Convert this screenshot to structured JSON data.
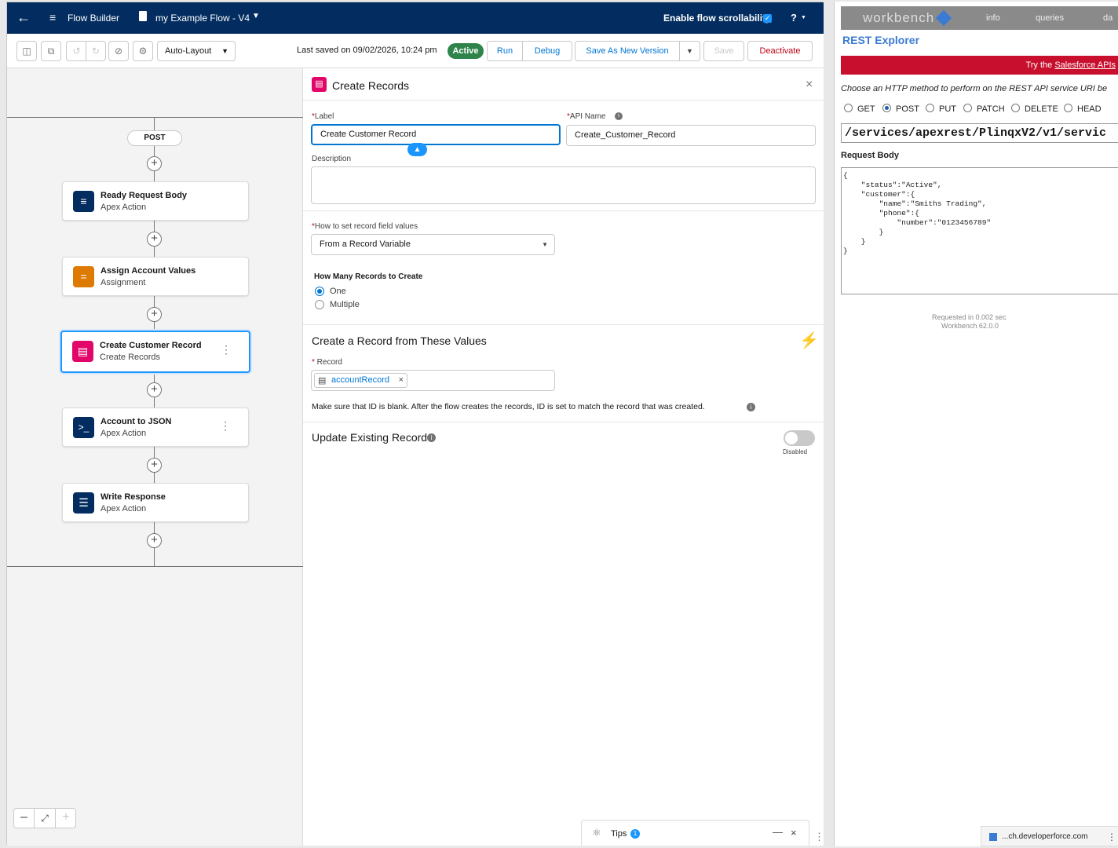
{
  "topbar": {
    "app_name": "Flow Builder",
    "flow_name": "my Example Flow - V4",
    "scroll_label": "Enable flow scrollability",
    "help": "?"
  },
  "toolbar": {
    "layout_select": "Auto-Layout",
    "last_saved": "Last saved on 09/02/2026, 10:24 pm",
    "status_badge": "Active",
    "run": "Run",
    "debug": "Debug",
    "save_as_new": "Save As New Version",
    "save": "Save",
    "deactivate": "Deactivate"
  },
  "canvas": {
    "start_label": "POST",
    "nodes": [
      {
        "title": "Ready Request Body",
        "subtitle": "Apex Action",
        "icon": "apex-action-icon",
        "color": "#032d60"
      },
      {
        "title": "Assign Account Values",
        "subtitle": "Assignment",
        "icon": "assignment-icon",
        "color": "#dd7a01"
      },
      {
        "title": "Create Customer Record",
        "subtitle": "Create Records",
        "icon": "create-records-icon",
        "color": "#e3066a"
      },
      {
        "title": "Account to JSON",
        "subtitle": "Apex Action",
        "icon": "apex-terminal-icon",
        "color": "#032d60"
      },
      {
        "title": "Write Response",
        "subtitle": "Apex Action",
        "icon": "list-icon",
        "color": "#032d60"
      }
    ]
  },
  "panel": {
    "title": "Create Records",
    "label_label": "Label",
    "label_value": "Create Customer Record",
    "api_name_label": "API Name",
    "api_name_value": "Create_Customer_Record",
    "description_label": "Description",
    "how_to_set_label": "How to set record field values",
    "how_to_set_value": "From a Record Variable",
    "how_many_label": "How Many Records to Create",
    "option_one": "One",
    "option_multiple": "Multiple",
    "section_title": "Create a Record from These Values",
    "record_label": "Record",
    "record_pill": "accountRecord",
    "help_text": "Make sure that ID is blank. After the flow creates the records, ID is set to match the record that was created.",
    "update_label": "Update Existing Record",
    "toggle_state": "Disabled"
  },
  "tips": {
    "label": "Tips",
    "count": "1"
  },
  "workbench": {
    "logo": "workbench",
    "menu_info": "info",
    "menu_queries": "queries",
    "menu_cut": "da",
    "title": "REST Explorer",
    "banner_prefix": "Try the ",
    "banner_link": "Salesforce APIs",
    "instruction": "Choose an HTTP method to perform on the REST API service URI be",
    "methods": [
      "GET",
      "POST",
      "PUT",
      "PATCH",
      "DELETE",
      "HEAD"
    ],
    "selected_method": "POST",
    "uri": "/services/apexrest/PlinqxV2/v1/servic",
    "request_body_label": "Request Body",
    "request_body": "{\n    \"status\":\"Active\",\n    \"customer\":{\n        \"name\":\"Smiths Trading\",\n        \"phone\":{\n            \"number\":\"0123456789\"\n        }\n    }\n}",
    "requested_time": "Requested in 0.002 sec",
    "version": "Workbench 62.0.0",
    "status_url": "...ch.developerforce.com"
  }
}
